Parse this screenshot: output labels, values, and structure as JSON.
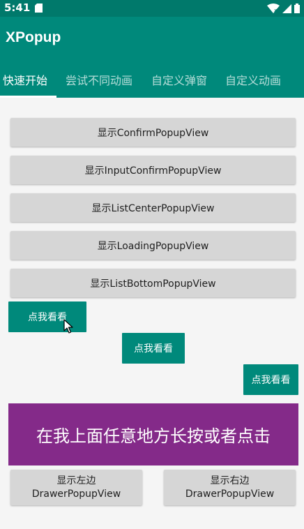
{
  "status_bar": {
    "time": "5:41"
  },
  "app_bar": {
    "title": "XPopup"
  },
  "tabs": [
    {
      "label": "快速开始",
      "active": true
    },
    {
      "label": "尝试不同动画",
      "active": false
    },
    {
      "label": "自定义弹窗",
      "active": false
    },
    {
      "label": "自定义动画",
      "active": false
    }
  ],
  "buttons": [
    {
      "label": "显示ConfirmPopupView"
    },
    {
      "label": "显示InputConfirmPopupView"
    },
    {
      "label": "显示ListCenterPopupView"
    },
    {
      "label": "显示LoadingPopupView"
    },
    {
      "label": "显示ListBottomPopupView"
    }
  ],
  "attach_buttons": [
    {
      "label": "点我看看"
    },
    {
      "label": "点我看看"
    },
    {
      "label": "点我看看"
    }
  ],
  "press_area": {
    "label": "在我上面任意地方长按或者点击"
  },
  "drawer_buttons": [
    {
      "line1": "显示左边",
      "line2": "DrawerPopupView"
    },
    {
      "line1": "显示右边",
      "line2": "DrawerPopupView"
    }
  ],
  "colors": {
    "primary": "#00897b",
    "primary_dark": "#00796b",
    "accent_purple": "#842a89",
    "button_gray": "#d6d6d6"
  }
}
